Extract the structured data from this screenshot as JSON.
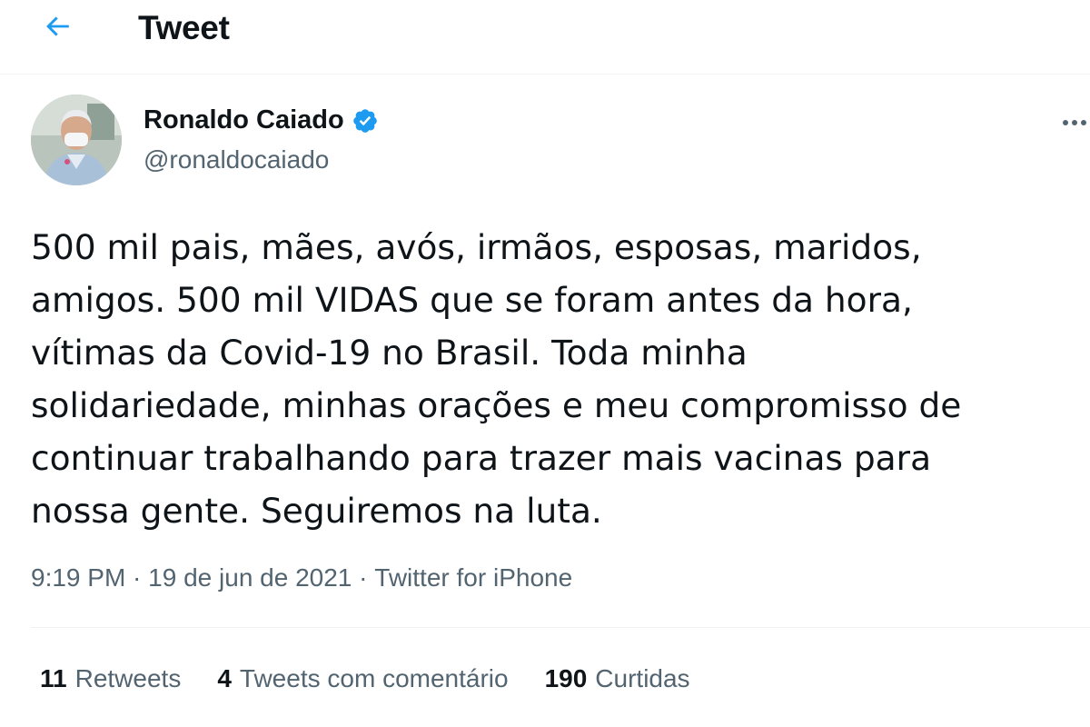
{
  "header": {
    "title": "Tweet",
    "back_icon": "arrow-left-icon",
    "accent_color": "#1d9bf0"
  },
  "author": {
    "name": "Ronaldo Caiado",
    "handle": "@ronaldocaiado",
    "verified": true,
    "verified_icon": "verified-badge-icon",
    "more_icon": "more-horizontal-icon"
  },
  "tweet": {
    "text": "500 mil pais, mães, avós, irmãos, esposas, maridos,\namigos. 500 mil VIDAS que se foram antes da hora,\nvítimas da Covid-19 no Brasil. Toda minha\nsolidariedade, minhas orações e meu compromisso de\ncontinuar trabalhando para trazer mais vacinas para\nnossa gente. Seguiremos na luta.",
    "time": "9:19 PM",
    "separator": " · ",
    "date": "19 de jun de 2021",
    "source": "Twitter for iPhone"
  },
  "stats": {
    "retweets_count": "11",
    "retweets_label": "Retweets",
    "quotes_count": "4",
    "quotes_label": "Tweets com comentário",
    "likes_count": "190",
    "likes_label": "Curtidas"
  }
}
